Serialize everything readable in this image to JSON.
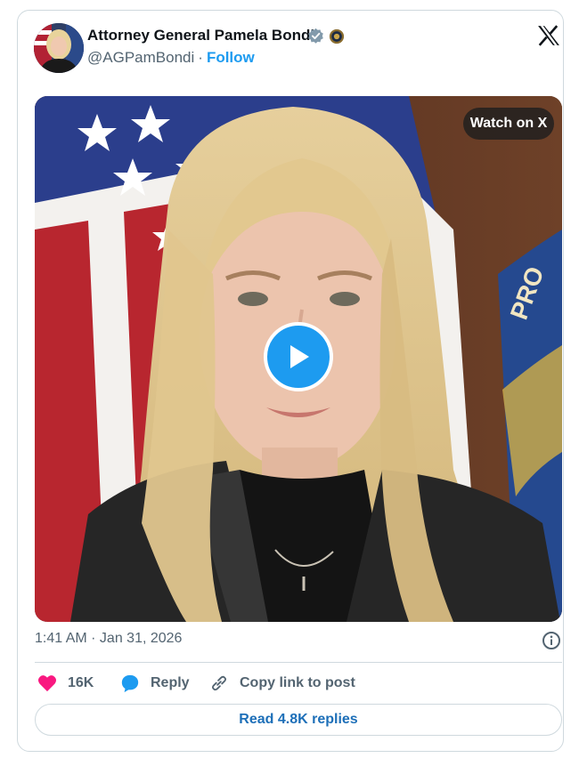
{
  "author": {
    "display_name": "Attorney General Pamela Bondi",
    "handle": "@AGPamBondi",
    "separator": "·",
    "follow_label": "Follow"
  },
  "media": {
    "watch_label": "Watch on X",
    "flag_text": "PRO"
  },
  "timestamp": "1:41 AM · Jan 31, 2026",
  "actions": {
    "like_count": "16K",
    "reply_label": "Reply",
    "copy_label": "Copy link to post"
  },
  "read_replies_label": "Read 4.8K replies",
  "colors": {
    "accent": "#1d9bf0",
    "like": "#f91880",
    "text_secondary": "#536471",
    "border": "#cfd9de"
  },
  "icons": [
    "verified-badge-icon",
    "seal-icon",
    "x-logo-icon",
    "play-icon",
    "info-icon",
    "heart-icon",
    "reply-bubble-icon",
    "link-icon"
  ]
}
